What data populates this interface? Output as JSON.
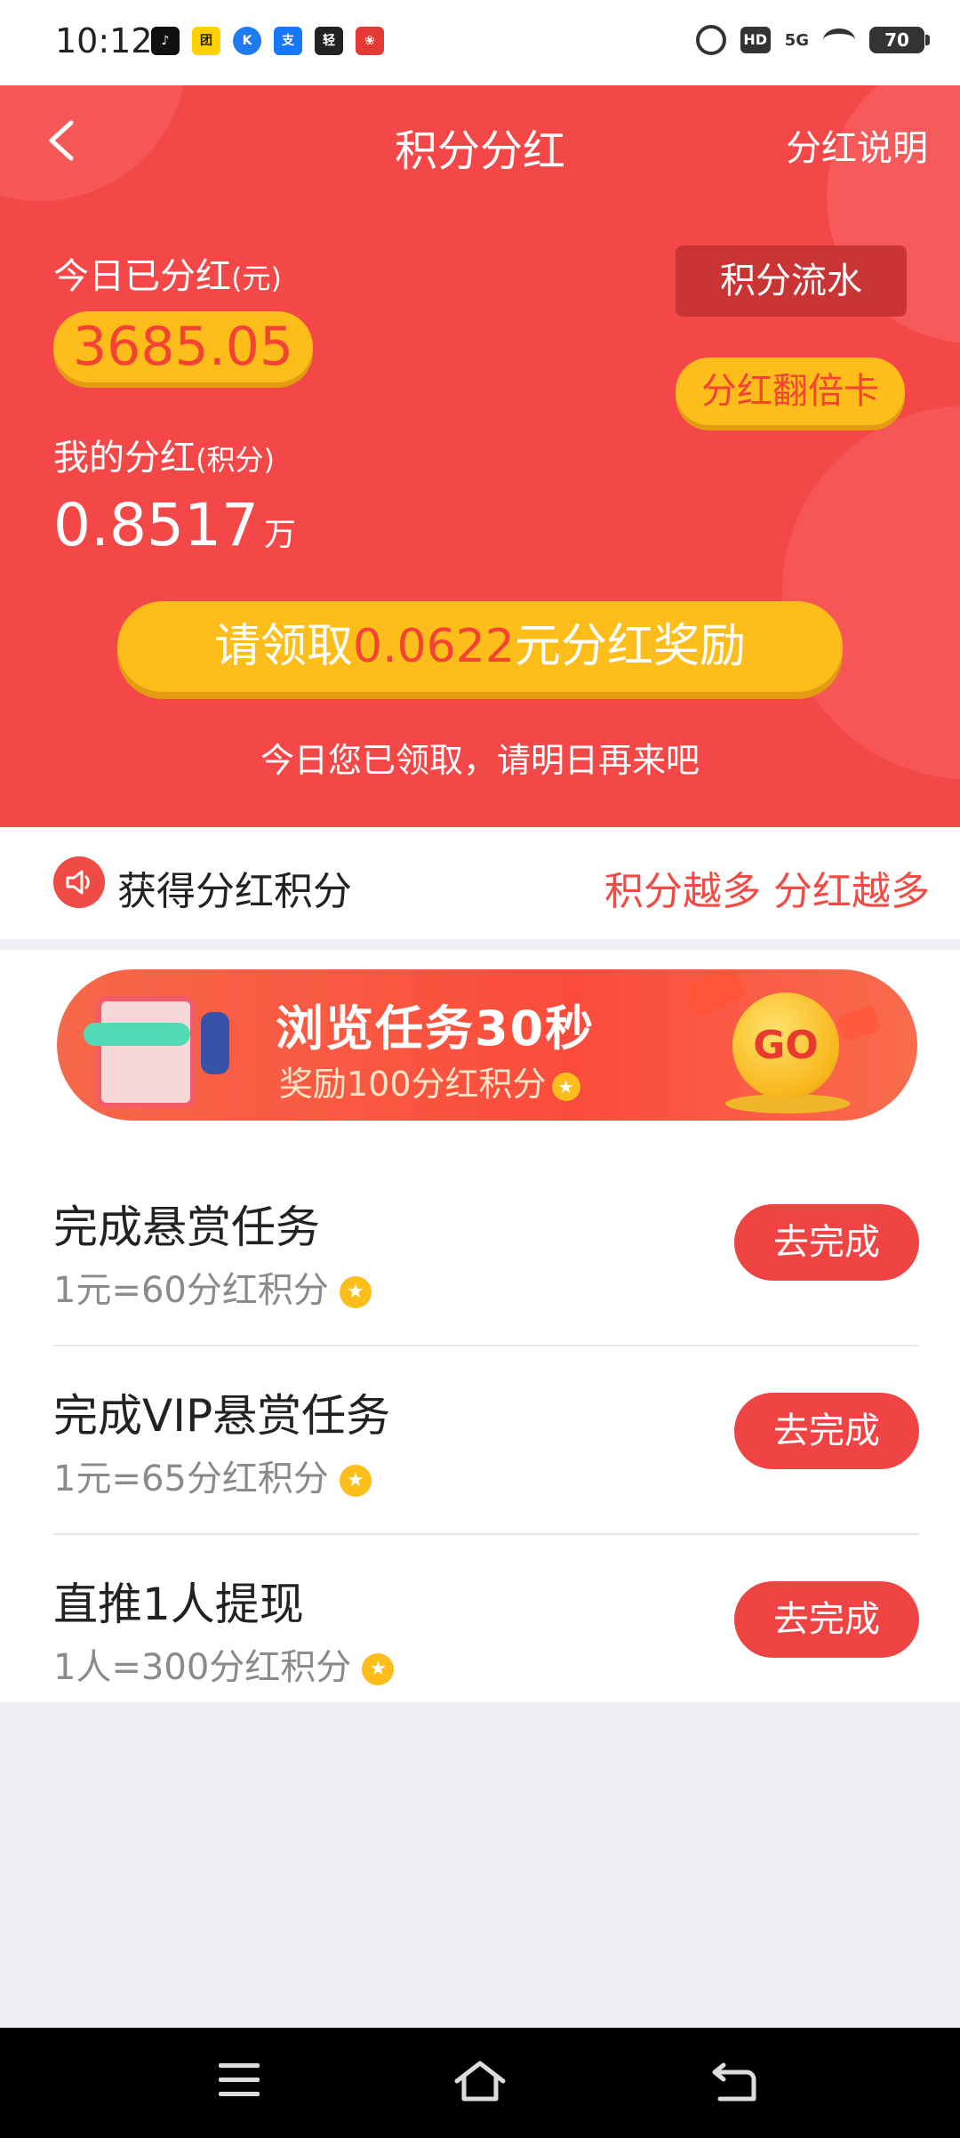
{
  "status_bar": {
    "time": "10:12",
    "apps": [
      {
        "icon": "tiktok-icon",
        "label": "♪",
        "color": "#111111"
      },
      {
        "icon": "meituan-icon",
        "label": "团",
        "color": "#ffd100"
      },
      {
        "icon": "kuaishou-k-icon",
        "label": "K",
        "color": "#1f7cf0"
      },
      {
        "icon": "alipay-icon",
        "label": "支",
        "color": "#1677ff"
      },
      {
        "icon": "qingyu-icon",
        "label": "轻",
        "color": "#222222"
      },
      {
        "icon": "redbox-icon",
        "label": "❀",
        "color": "#e53935"
      }
    ],
    "network": "5G",
    "hd": "HD",
    "battery": "70"
  },
  "nav": {
    "title": "积分分红",
    "right_link": "分红说明"
  },
  "hero": {
    "today_label": "今日已分红",
    "today_unit": "(元)",
    "today_amount": "3685.05",
    "flow_button": "积分流水",
    "double_card_button": "分红翻倍卡",
    "mine_label": "我的分红",
    "mine_unit": "(积分)",
    "mine_value": "0.8517",
    "mine_value_unit": "万",
    "claim_prefix": "请领取",
    "claim_amount": "0.0622",
    "claim_suffix": "元分红奖励",
    "note": "今日您已领取，请明日再来吧"
  },
  "promo": {
    "left": "获得分红积分",
    "right": "积分越多 分红越多"
  },
  "banner": {
    "title": "浏览任务30秒",
    "subtitle": "奖励100分红积分",
    "go": "GO"
  },
  "tasks": [
    {
      "title": "完成悬赏任务",
      "reward": "1元=60分红积分",
      "button": "去完成"
    },
    {
      "title": "完成VIP悬赏任务",
      "reward": "1元=65分红积分",
      "button": "去完成"
    },
    {
      "title": "直推1人提现",
      "reward": "1人=300分红积分",
      "button": "去完成"
    }
  ]
}
